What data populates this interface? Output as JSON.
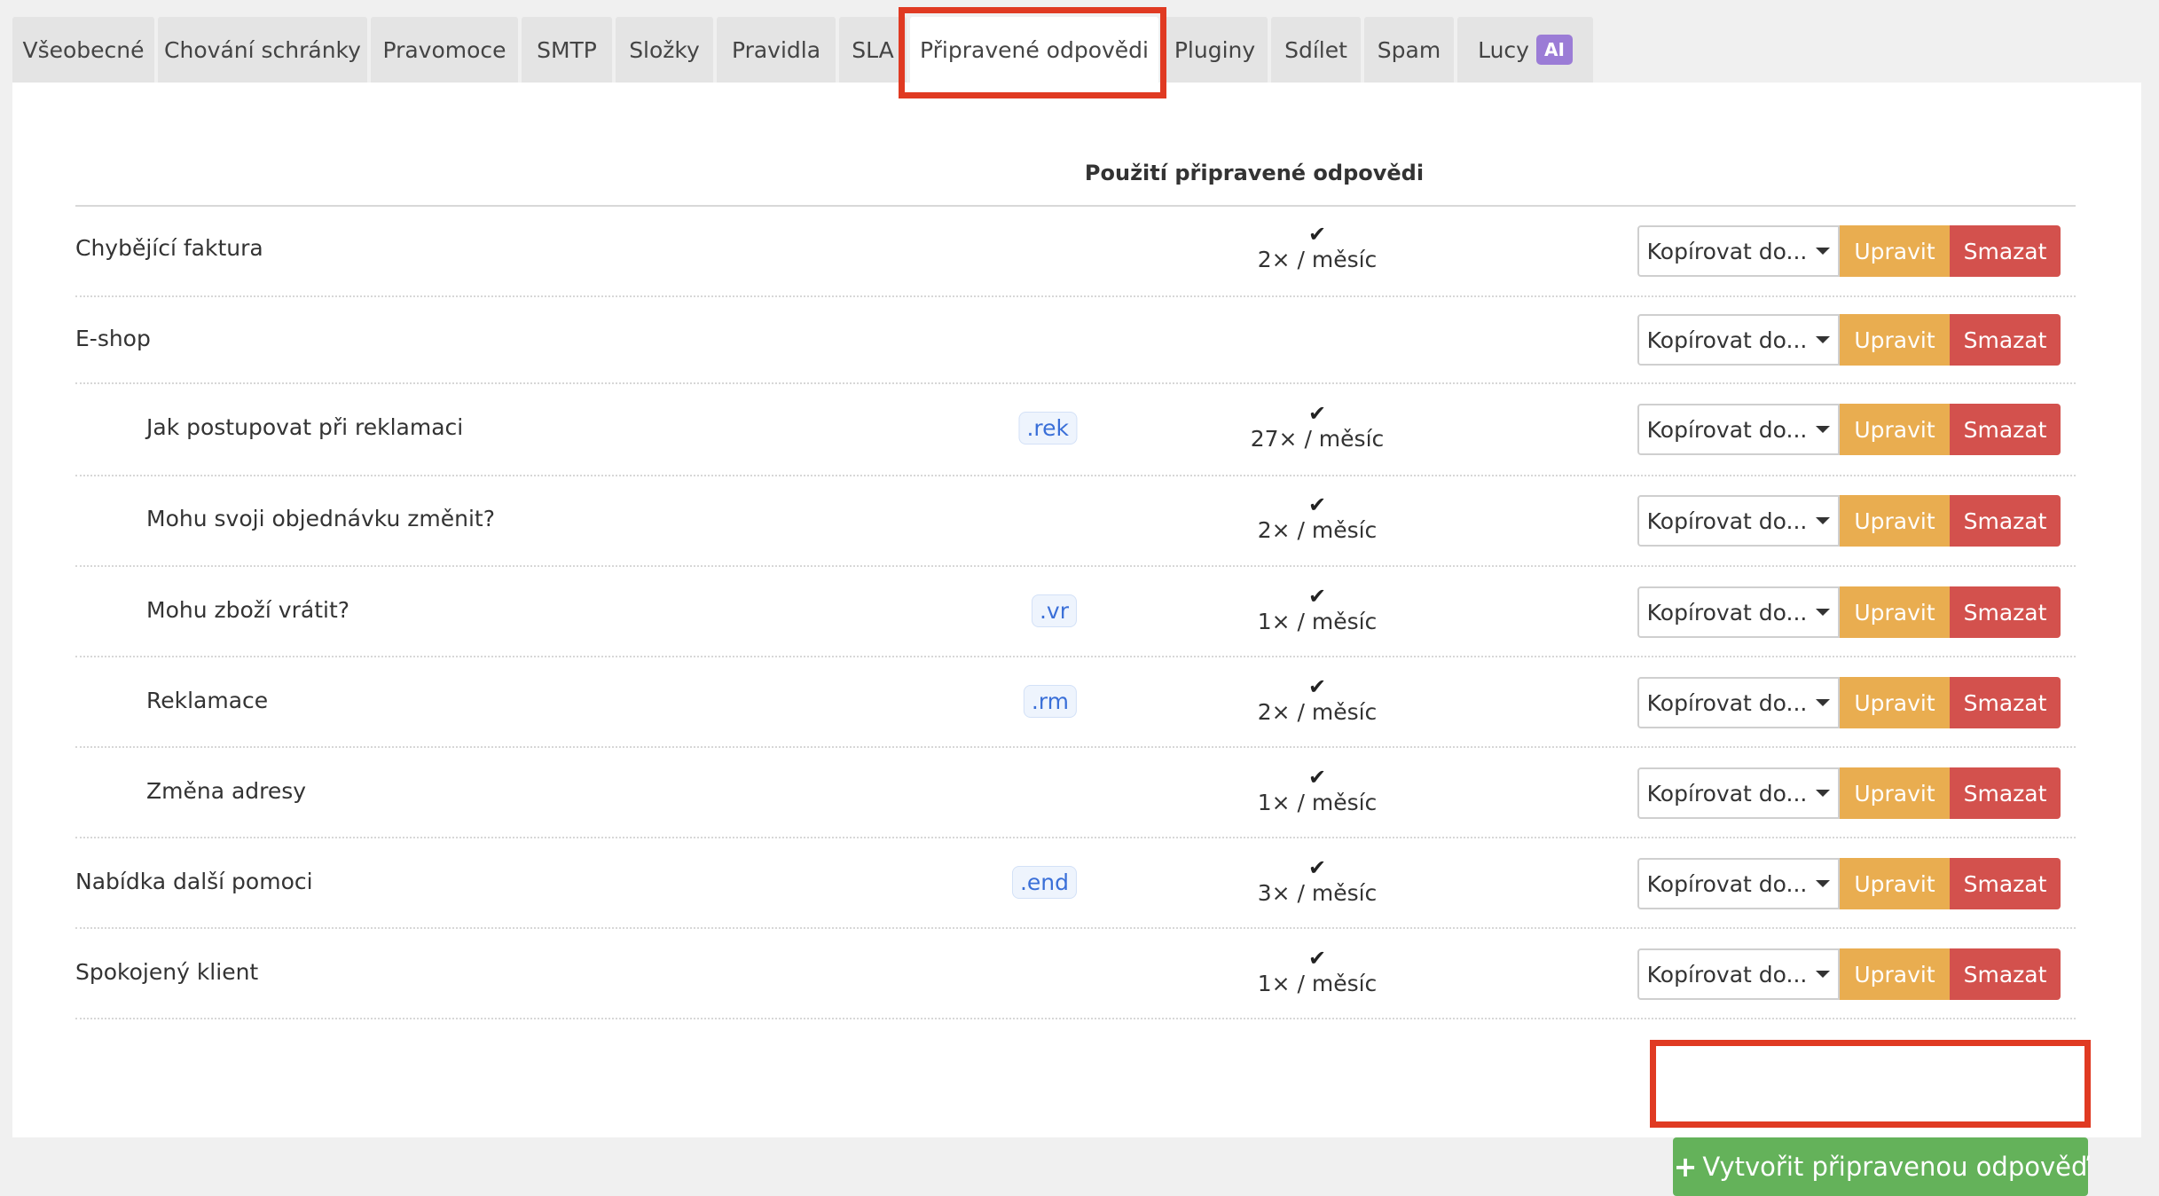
{
  "tabs": [
    {
      "label": "Všeobecné"
    },
    {
      "label": "Chování schránky"
    },
    {
      "label": "Pravomoce"
    },
    {
      "label": "SMTP"
    },
    {
      "label": "Složky"
    },
    {
      "label": "Pravidla"
    },
    {
      "label": "SLA"
    },
    {
      "label": "Připravené odpovědi"
    },
    {
      "label": "Pluginy"
    },
    {
      "label": "Sdílet"
    },
    {
      "label": "Spam"
    },
    {
      "label": "Lucy",
      "badge": "AI"
    }
  ],
  "active_tab": "Připravené odpovědi",
  "table": {
    "usage_header": "Použití připravené odpovědi"
  },
  "rows": [
    {
      "name": "Chybějící faktura",
      "shortcut": "",
      "usage": "2× / měsíc"
    },
    {
      "name": "E-shop",
      "shortcut": "",
      "usage": ""
    },
    {
      "name": "Jak postupovat při reklamaci",
      "shortcut": ".rek",
      "usage": "27× / měsíc"
    },
    {
      "name": "Mohu svoji objednávku změnit?",
      "shortcut": "",
      "usage": "2× / měsíc"
    },
    {
      "name": "Mohu zboží vrátit?",
      "shortcut": ".vr",
      "usage": "1× / měsíc"
    },
    {
      "name": "Reklamace",
      "shortcut": ".rm",
      "usage": "2× / měsíc"
    },
    {
      "name": "Změna adresy",
      "shortcut": "",
      "usage": "1× / měsíc"
    },
    {
      "name": "Nabídka další pomoci",
      "shortcut": ".end",
      "usage": "3× / měsíc"
    },
    {
      "name": "Spokojený klient",
      "shortcut": "",
      "usage": "1× / měsíc"
    }
  ],
  "actions": {
    "copy_label": "Kopírovat do...",
    "edit_label": "Upravit",
    "delete_label": "Smazat"
  },
  "create_button_label": "Vytvořit připravenou odpověď",
  "colors": {
    "edit": "#e9ad50",
    "delete": "#d3514d",
    "create": "#64b25a",
    "highlight": "#e03a22",
    "ai_badge": "#9b7cd6"
  }
}
